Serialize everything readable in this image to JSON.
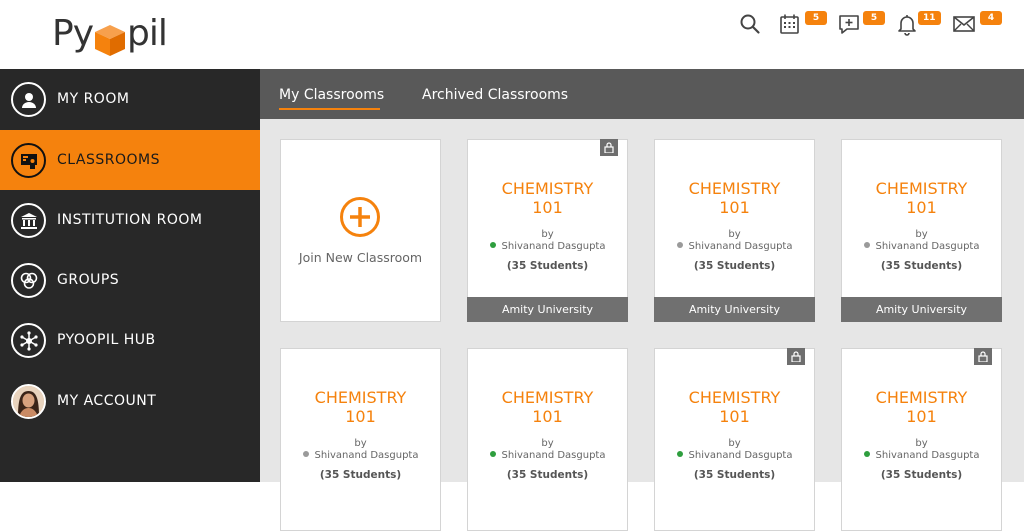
{
  "brand": {
    "logo_left": "Py",
    "logo_right": "pil",
    "accent": "#f5820d"
  },
  "header": {
    "icons": [
      {
        "name": "search-icon"
      },
      {
        "name": "calendar-icon",
        "badge": "5"
      },
      {
        "name": "chat-icon",
        "badge": "5"
      },
      {
        "name": "bell-icon",
        "badge": "11"
      },
      {
        "name": "mail-icon",
        "badge": "4"
      }
    ]
  },
  "sidebar": {
    "items": [
      {
        "label": "MY ROOM",
        "icon": "user-icon",
        "active": false
      },
      {
        "label": "CLASSROOMS",
        "icon": "classroom-icon",
        "active": true
      },
      {
        "label": "INSTITUTION ROOM",
        "icon": "institution-icon",
        "active": false
      },
      {
        "label": "GROUPS",
        "icon": "groups-icon",
        "active": false
      },
      {
        "label": "PYOOPIL HUB",
        "icon": "hub-icon",
        "active": false
      },
      {
        "label": "MY ACCOUNT",
        "icon": "avatar",
        "active": false
      }
    ]
  },
  "tabs": [
    {
      "label": "My Classrooms",
      "active": true
    },
    {
      "label": "Archived Classrooms",
      "active": false
    }
  ],
  "join": {
    "label": "Join New Classroom"
  },
  "classrooms": [
    {
      "title": "CHEMISTRY 101",
      "by": "by",
      "teacher": "Shivanand Dasgupta",
      "status": "online",
      "students": "(35 Students)",
      "institution": "Amity University",
      "locked": true
    },
    {
      "title": "CHEMISTRY 101",
      "by": "by",
      "teacher": "Shivanand Dasgupta",
      "status": "offline",
      "students": "(35 Students)",
      "institution": "Amity University",
      "locked": false
    },
    {
      "title": "CHEMISTRY 101",
      "by": "by",
      "teacher": "Shivanand Dasgupta",
      "status": "offline",
      "students": "(35 Students)",
      "institution": "Amity University",
      "locked": false
    },
    {
      "title": "CHEMISTRY 101",
      "by": "by",
      "teacher": "Shivanand Dasgupta",
      "status": "offline",
      "students": "(35 Students)",
      "institution": "",
      "locked": false
    },
    {
      "title": "CHEMISTRY 101",
      "by": "by",
      "teacher": "Shivanand Dasgupta",
      "status": "online",
      "students": "(35 Students)",
      "institution": "",
      "locked": false
    },
    {
      "title": "CHEMISTRY 101",
      "by": "by",
      "teacher": "Shivanand Dasgupta",
      "status": "online",
      "students": "(35 Students)",
      "institution": "",
      "locked": true
    },
    {
      "title": "CHEMISTRY 101",
      "by": "by",
      "teacher": "Shivanand Dasgupta",
      "status": "online",
      "students": "(35 Students)",
      "institution": "",
      "locked": true
    }
  ],
  "colors": {
    "online": "#2e9e3e",
    "offline": "#9a9a9a"
  }
}
